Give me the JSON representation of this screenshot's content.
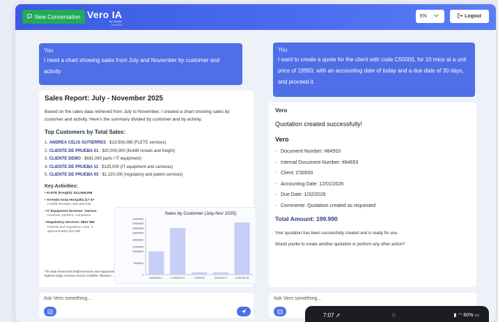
{
  "header": {
    "new_conversation": "New Conversation",
    "brand": "Vero IA",
    "brand_sub": "By Sakdar",
    "brand_sub2": "m4clk2la",
    "language": "EN",
    "logout": "Logout"
  },
  "left": {
    "you_label": "You",
    "you_message": "I need a chart showing sales from July and November by customer and activity",
    "report_title": "Sales Report: July - November 2025",
    "report_intro": "Based on the sales data retrieved from July to November, I created a chart showing sales by customer and activity. Here's the summary divided by customer and by activity.",
    "top_title": "Top Customers by Total Sales:",
    "top_customers": [
      {
        "n": "1.",
        "name": "ANDREA CELIS GUTIERRES",
        "rest": " : $13,508,098 (FLETE services)"
      },
      {
        "n": "2.",
        "name": "CLIENTE DE PRUEBA 01",
        "rest": " : $20,000,000 (forklift rentals and freight)"
      },
      {
        "n": "3.",
        "name": "CLIENTE DEMO",
        "rest": " : $881,060 parts / IT equipment)"
      },
      {
        "n": "4.",
        "name": "CLIENTE DE PRUEBA 11",
        "rest": " : $125,000 (IT equipment and cameras)"
      },
      {
        "n": "5.",
        "name": "CLIENTE DE PRUEBA 03",
        "rest": " : $1,220,000 (regulatory and patent services)"
      }
    ],
    "activities_title": "Key Activities:",
    "activities": [
      {
        "main": "FLETE (Freight): $13,508,098",
        "sub": ""
      },
      {
        "main": "Arrendo Grúa Horquilla (17 57",
        "sub": "Forklift Rentals): $20,000,000"
      },
      {
        "main": "IT Equipment Services: Various",
        "sub": "monitors, printers, computers"
      },
      {
        "main": "Regulatory Services: $811 060",
        "sub": "Patents and regulatory certs, 3 approximately $13.5M"
      }
    ],
    "activities_note": "The data shows that freight services and equipment rentals dominate current services, with CLIENTE DE PRUEBA 01's forklift rentals being the highest single revenue service at $20M, followed...",
    "ask_placeholder": "Ask Vero something..."
  },
  "right": {
    "you_label": "You",
    "you_message": "I want to create a quote for the client with code C50000, for 10 mice at a unit price of 19993, with an accounting date of today and a due date of 30 days, and proceed it.",
    "vero_label": "Vero",
    "status": "Quotation created successfully!",
    "vero_heading": "Vero",
    "details": [
      "Document Number: #84553",
      "Internal Document Number: #84653",
      "Client: C50000",
      "Accounting Date: 12/01/2026",
      "Due Date: 1/32/2026",
      "Commente: Quotation created as requested"
    ],
    "total": "Total Amount: 199.990",
    "note1": "Your quotation has been successfully created and is ready for use.",
    "note2": "Would youlite to create another quotation or perform any other action?",
    "ask_placeholder": "Ask Vero something..."
  },
  "phone_status": {
    "time": "7:07",
    "battery": "60%"
  },
  "colors": {
    "header": "#4a6cf0",
    "accent": "#4f6fe8",
    "new_conv": "#24a95a",
    "bars": "#c7cef7"
  },
  "chart_data": {
    "type": "bar",
    "title": "Sales by Customer (July-Nov 2025)",
    "categories": [
      "ANDREA C.",
      "CLIENTE 01",
      "CLIENTE",
      "CLIENTE 0",
      "CLIENTE 00"
    ],
    "values": [
      10000000,
      20000000,
      1000000,
      1000000,
      22500000
    ],
    "ylim": [
      0,
      24000000
    ],
    "yticks": [
      0,
      5000000,
      10000000,
      12000000,
      15000000,
      18000000,
      20000000,
      22000000,
      24000000
    ],
    "xlabel": "",
    "ylabel": "",
    "grid": false
  }
}
